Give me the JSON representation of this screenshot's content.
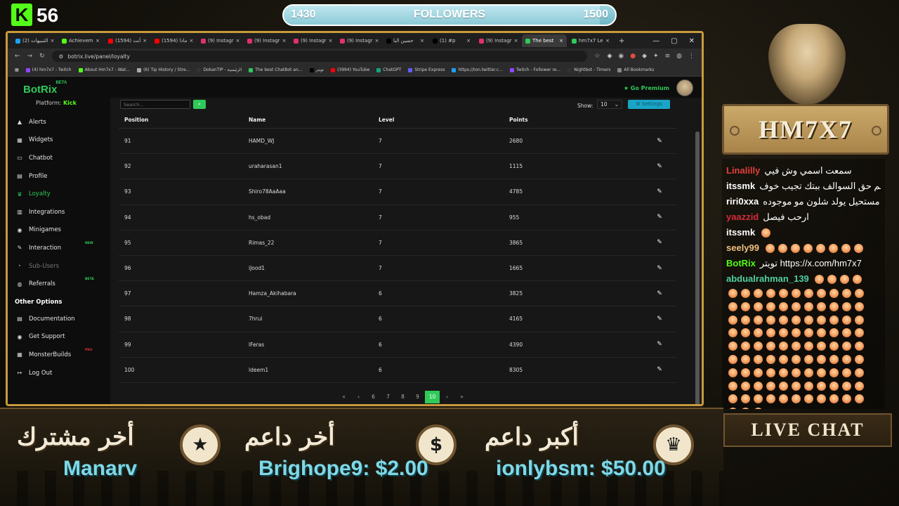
{
  "overlay": {
    "kick_count": "56",
    "followers": {
      "current": "1430",
      "label": "FOLLOWERS",
      "goal": "1500",
      "progress": 0.953
    },
    "streamer_name": "HM7X7",
    "live_chat_label": "LIVE CHAT",
    "bottom": [
      {
        "title": "أخر مشترك",
        "value": "Manarv",
        "icon": "★"
      },
      {
        "title": "أخر داعم",
        "value": "Brighope9: $2.00",
        "icon": "$"
      },
      {
        "title": "أكبر داعم",
        "value": "ionlybsm: $50.00",
        "icon": "♛"
      }
    ]
  },
  "browser": {
    "tabs": [
      {
        "label": "(2) التنبيهات",
        "color": "#1da1f2"
      },
      {
        "label": "Achievem",
        "color": "#53fc18"
      },
      {
        "label": "(1594) أنت",
        "color": "#ff0000"
      },
      {
        "label": "(1594) ماذا",
        "color": "#ff0000"
      },
      {
        "label": "(9) Instagr",
        "color": "#e1306c"
      },
      {
        "label": "(9) Instagr",
        "color": "#e1306c"
      },
      {
        "label": "(9) Instagr",
        "color": "#e1306c"
      },
      {
        "label": "(9) Instagr",
        "color": "#e1306c"
      },
      {
        "label": "حسين البا",
        "color": "#000000"
      },
      {
        "label": "(1) #p",
        "color": "#000000"
      },
      {
        "label": "(9) Instagr",
        "color": "#e1306c"
      },
      {
        "label": "The best",
        "color": "#2fca5a",
        "active": true
      },
      {
        "label": "hm7x7 Le",
        "color": "#2fca5a"
      }
    ],
    "url": "botrix.live/panel/loyalty",
    "bookmarks": [
      {
        "label": "(4) hm7x7 - Twitch",
        "color": "#9146ff"
      },
      {
        "label": "About Hm7x7 - Wat...",
        "color": "#53fc18"
      },
      {
        "label": "(6) Tip History / Stre...",
        "color": "#aaaaaa"
      },
      {
        "label": "DokanTIP - الرئيسية",
        "color": "#333333"
      },
      {
        "label": "The best ChatBot an...",
        "color": "#2fca5a"
      },
      {
        "label": "تويتر",
        "color": "#000000"
      },
      {
        "label": "(3994) YouTube",
        "color": "#ff0000"
      },
      {
        "label": "ChatGPT",
        "color": "#10a37f"
      },
      {
        "label": "Stripe Express",
        "color": "#635bff"
      },
      {
        "label": "https://ton.twitter.c...",
        "color": "#1da1f2"
      },
      {
        "label": "Twitch - Follower re...",
        "color": "#9146ff"
      },
      {
        "label": "Nightbot - Timers",
        "color": "#2d3436"
      },
      {
        "label": "All Bookmarks",
        "color": "#888888"
      }
    ]
  },
  "app": {
    "brand": "BotRix",
    "beta": "BETA",
    "platform_label": "Platform:",
    "platform": "Kick",
    "go_premium": "Go Premium",
    "nav": [
      {
        "label": "Alerts",
        "icon": "▲"
      },
      {
        "label": "Widgets",
        "icon": "▦"
      },
      {
        "label": "Chatbot",
        "icon": "▭"
      },
      {
        "label": "Profile",
        "icon": "▤"
      },
      {
        "label": "Loyalty",
        "icon": "♛",
        "active": true
      },
      {
        "label": "Integrations",
        "icon": "▥"
      },
      {
        "label": "Minigames",
        "icon": "◉"
      },
      {
        "label": "Interaction",
        "icon": "✎",
        "badge": "NEW"
      },
      {
        "label": "Sub-Users",
        "icon": "•",
        "muted": true
      },
      {
        "label": "Referrals",
        "icon": "◍",
        "badge": "BETA"
      }
    ],
    "other_heading": "Other Options",
    "other": [
      {
        "label": "Documentation",
        "icon": "▤"
      },
      {
        "label": "Get Support",
        "icon": "◉"
      },
      {
        "label": "MonsterBuilds",
        "icon": "▦",
        "badge": "PRO"
      },
      {
        "label": "Log Out",
        "icon": "↦"
      }
    ],
    "search_placeholder": "Search...",
    "show_label": "Show:",
    "show_value": "10",
    "settings_label": "Settings",
    "columns": [
      "Position",
      "Name",
      "Level",
      "Points"
    ],
    "rows": [
      {
        "position": "91",
        "name": "HAMD_WJ",
        "level": "7",
        "points": "2680"
      },
      {
        "position": "92",
        "name": "uraharasan1",
        "level": "7",
        "points": "1115"
      },
      {
        "position": "93",
        "name": "Shiro78AaAaa",
        "level": "7",
        "points": "4785"
      },
      {
        "position": "94",
        "name": "hs_obad",
        "level": "7",
        "points": "955"
      },
      {
        "position": "95",
        "name": "Rimas_22",
        "level": "7",
        "points": "3865"
      },
      {
        "position": "96",
        "name": "iJood1",
        "level": "7",
        "points": "1665"
      },
      {
        "position": "97",
        "name": "Hamza_Akihabara",
        "level": "6",
        "points": "3825"
      },
      {
        "position": "98",
        "name": "7hrui",
        "level": "6",
        "points": "4165"
      },
      {
        "position": "99",
        "name": "lFeras",
        "level": "6",
        "points": "4390"
      },
      {
        "position": "100",
        "name": "ldeem1",
        "level": "6",
        "points": "8305"
      }
    ],
    "pagination": [
      "«",
      "‹",
      "6",
      "7",
      "8",
      "9",
      "10",
      "›",
      "»"
    ],
    "current_page": "10"
  },
  "chat": [
    {
      "user": "Linalilly",
      "color": "#e0403a",
      "text": "سمعت اسمي وش فيي"
    },
    {
      "user": "itssmk",
      "color": "#ffffff",
      "text": "لهم حق السوالف ببتك تجيب خوف"
    },
    {
      "user": "riri0xxa",
      "color": "#ffffff",
      "text": "مستحيل يولد شلون مو موجوده"
    },
    {
      "user": "yaazzid",
      "color": "#d62b3b",
      "text": "ارحب فيصل"
    },
    {
      "user": "itssmk",
      "color": "#ffffff",
      "text": "",
      "emotes": 1
    },
    {
      "user": "seely99",
      "color": "#f0c080",
      "text": "",
      "emotes": 8
    },
    {
      "user": "BotRix",
      "color": "#53fc18",
      "text": "تويتر https://x.com/hm7x7"
    },
    {
      "user": "abdualrahman_139",
      "color": "#4fd0a0",
      "text": "",
      "emotes": 4
    }
  ],
  "emote_lines": [
    11,
    11,
    11,
    11,
    11,
    11,
    11,
    11,
    11,
    3
  ]
}
